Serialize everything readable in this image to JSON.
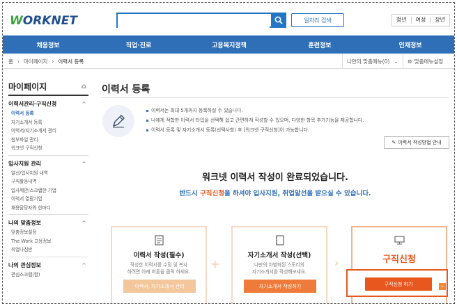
{
  "header": {
    "logo_mark": "W",
    "logo_text": "ORKNET",
    "search_placeholder": "",
    "job_search_label": "일자리 검색",
    "user_links": [
      "청년",
      "여성",
      "장년"
    ]
  },
  "gnb": [
    "채용정보",
    "직업·진로",
    "고용복지정책",
    "훈련정보",
    "인재정보"
  ],
  "breadcrumb": {
    "home": "홈",
    "level1": "마이페이지",
    "current": "이력서 등록",
    "my_menu": "나만의 맞춤메뉴(0)",
    "my_menu_settings": "맞춤메뉴설정"
  },
  "sidebar": {
    "title": "마이페이지",
    "groups": [
      {
        "title": "이력서관리·구직신청",
        "items": [
          "이력서 등록",
          "자기소개서 등록",
          "이력서/자기소개서 관리",
          "첨부파일 관리",
          "워크넷 구직신청"
        ]
      },
      {
        "title": "입사지원 관리",
        "items": [
          "알선/입사지원 내역",
          "구직활동내역",
          "입사제안/스크랩한 기업",
          "이력서 열람기업",
          "채용담당자와 한마디"
        ]
      },
      {
        "title": "나의 맞춤정보",
        "items": [
          "맞춤정보설정",
          "The Work 고용정보",
          "취업나침반"
        ]
      },
      {
        "title": "나의 관심정보",
        "items": [
          "관심스크랩(함)"
        ]
      }
    ]
  },
  "main": {
    "title": "이력서 등록",
    "notes": [
      "이력서는 최대 5개까지 등록하실 수 있습니다.",
      "나에게 적합한 이력서 타입을 선택해 쉽고 간편하게 작성할 수 있으며, 다양한 항목 추가기능을 제공합니다.",
      "이력서 등록 및 자기소개서 등록(선택사항) 후 [워크넷 구직신청]이 가능합니다."
    ],
    "guide_button": "이력서 작성방법 안내",
    "headline": "워크넷 이력서 작성이 완료되었습니다.",
    "sub_prefix": "반드시 ",
    "sub_highlight": "구직신청",
    "sub_suffix": "을 하셔야 입사지원, 취업알선을 받으실 수 있습니다."
  },
  "cards": [
    {
      "title": "이력서 작성(필수)",
      "desc1": "작성한 이력서를 수정 및 복사",
      "desc2": "하려면 아래 버튼을 클릭 하세요.",
      "button": "이력서, 자기소개서 관리"
    },
    {
      "title": "자기소개서 작성(선택)",
      "desc1": "나만의 차별화된 스토리의",
      "desc2": "자기소개서를 작성해보세요.",
      "button": "자기소개서 작성하기"
    },
    {
      "title": "구직신청",
      "button": "구직신청 하기"
    }
  ],
  "colors": {
    "brand_blue": "#2f6fb7",
    "accent_orange": "#e8571e",
    "logo_green": "#37a33a"
  }
}
